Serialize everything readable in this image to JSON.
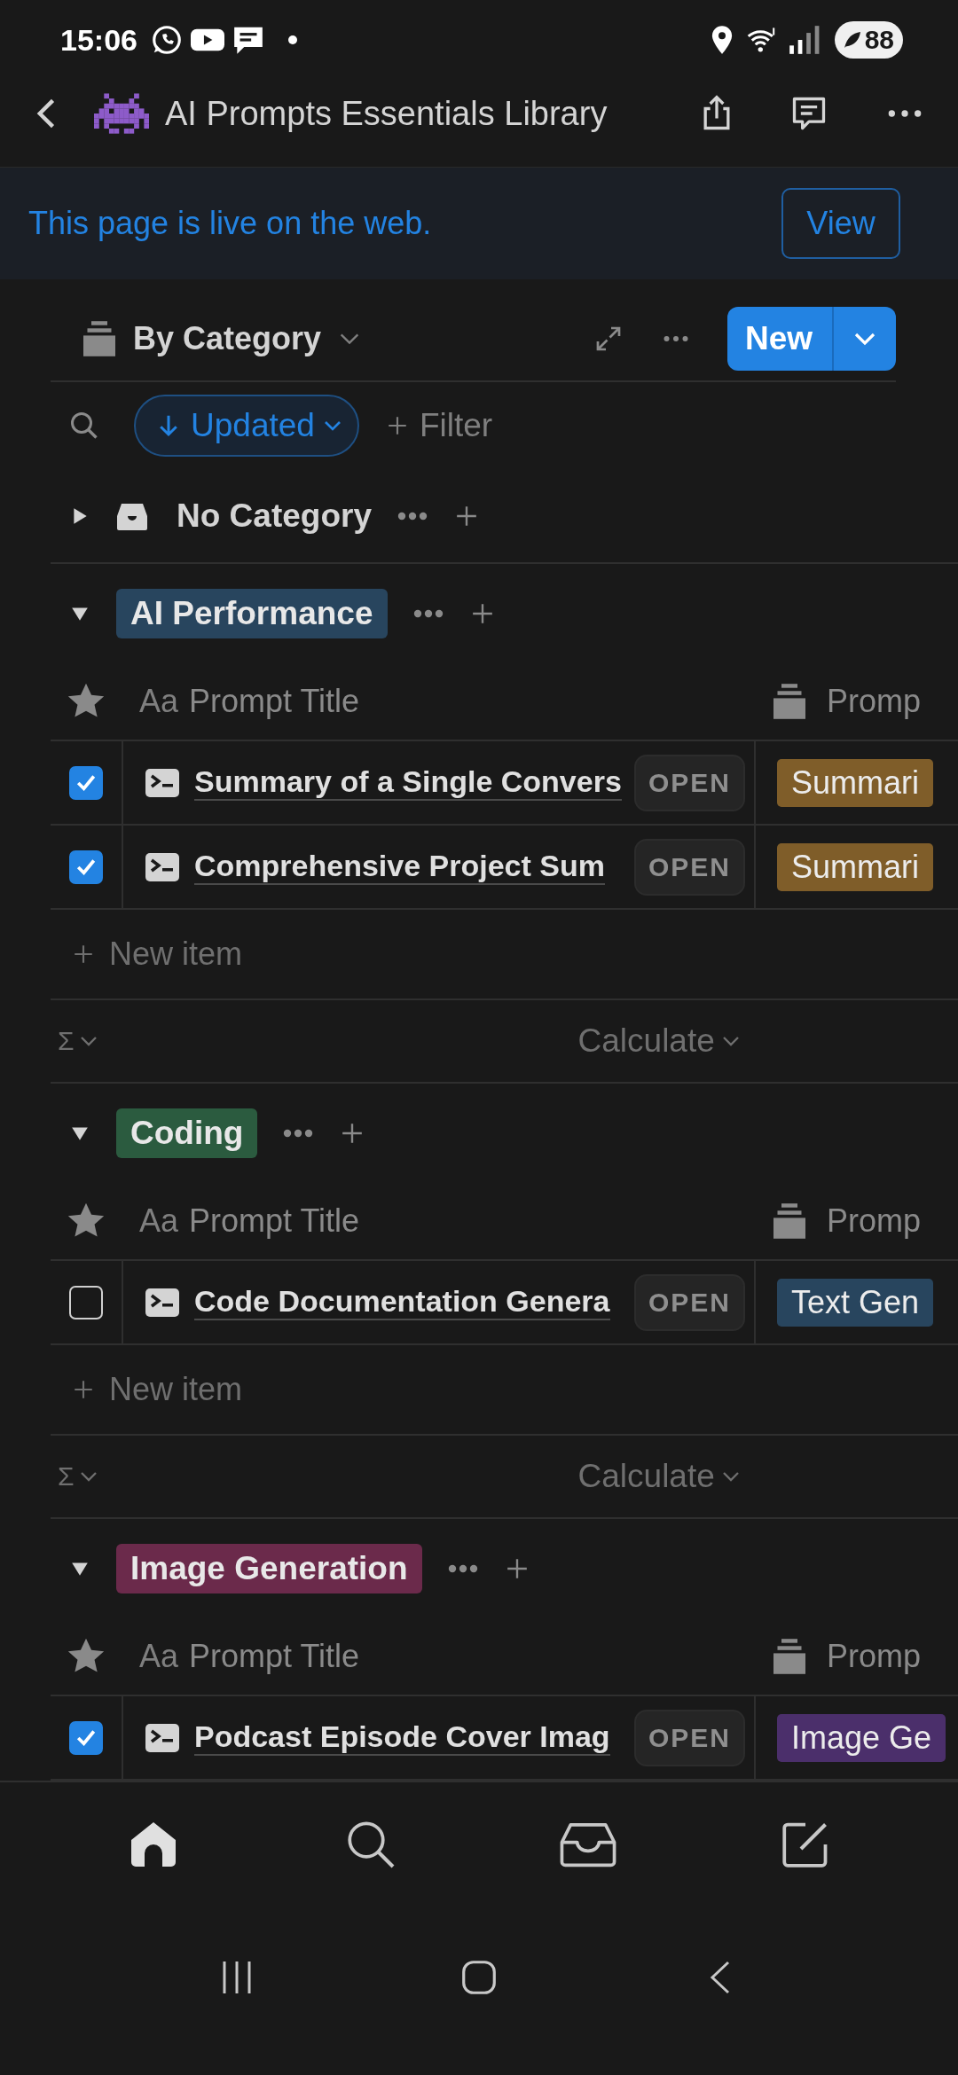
{
  "status_bar": {
    "time": "15:06",
    "battery": "88"
  },
  "header": {
    "title": "AI Prompts Essentials Library"
  },
  "banner": {
    "message": "This page is live on the web.",
    "button": "View"
  },
  "view_bar": {
    "view_name": "By Category",
    "new_button": "New"
  },
  "filter_bar": {
    "sort": "Updated",
    "filter": "Filter"
  },
  "groups": [
    {
      "kind": "uncategorized",
      "name": "No Category",
      "expanded": false
    },
    {
      "kind": "tag",
      "name": "AI Performance",
      "color": "#28455e",
      "expanded": true,
      "columns": {
        "title_icon": "Aa",
        "title": "Prompt Title",
        "column_2": "Promp"
      },
      "rows": [
        {
          "title": "Summary of a Single Convers",
          "checked": true,
          "open": "OPEN",
          "tag": "Summari",
          "color": "#7f5d29"
        },
        {
          "title": "Comprehensive Project Sum",
          "checked": true,
          "open": "OPEN",
          "tag": "Summari",
          "color": "#7f5d29"
        }
      ],
      "new_item": "New item",
      "sum_symbol": "Σ",
      "calculate": "Calculate"
    },
    {
      "kind": "tag",
      "name": "Coding",
      "color": "#2b5b3f",
      "expanded": true,
      "columns": {
        "title_icon": "Aa",
        "title": "Prompt Title",
        "column_2": "Promp"
      },
      "rows": [
        {
          "title": "Code Documentation Genera",
          "checked": false,
          "open": "OPEN",
          "tag": "Text Gen",
          "color": "#28455e"
        }
      ],
      "new_item": "New item",
      "sum_symbol": "Σ",
      "calculate": "Calculate"
    },
    {
      "kind": "tag",
      "name": "Image Generation",
      "color": "#6b2a4b",
      "expanded": true,
      "columns": {
        "title_icon": "Aa",
        "title": "Prompt Title",
        "column_2": "Promp"
      },
      "rows": [
        {
          "title": "Podcast Episode Cover Imag",
          "checked": true,
          "open": "OPEN",
          "tag": "Image Ge",
          "color": "#4b2f6b"
        }
      ]
    }
  ],
  "bottom_nav": [
    {
      "kind": "home",
      "selected": true
    },
    {
      "kind": "search",
      "selected": false
    },
    {
      "kind": "inbox",
      "selected": false
    },
    {
      "kind": "compose",
      "selected": false
    }
  ]
}
